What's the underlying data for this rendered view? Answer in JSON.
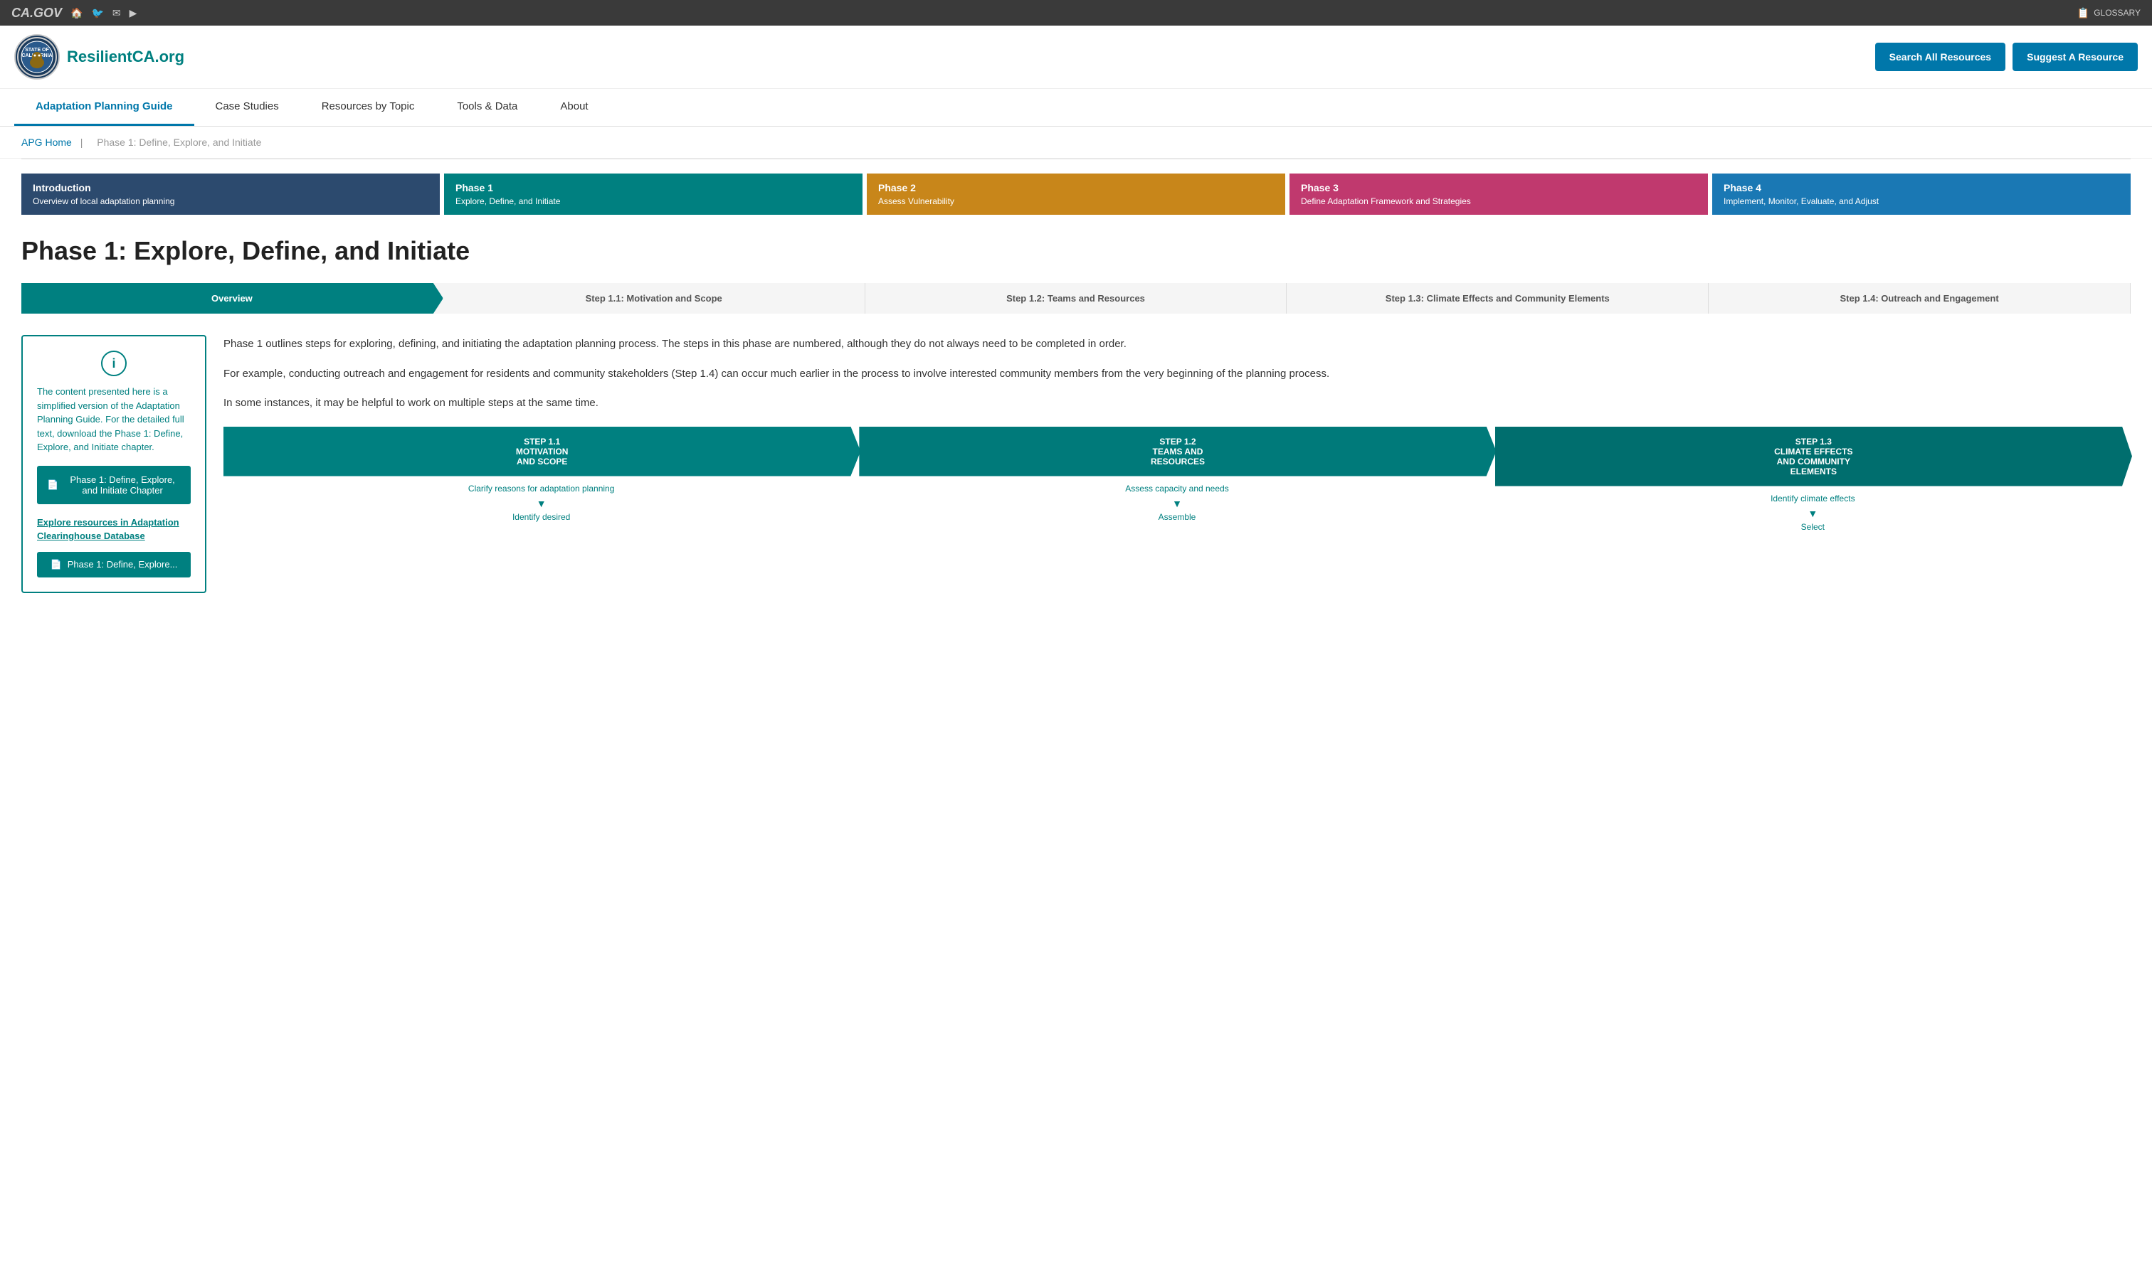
{
  "topbar": {
    "logo_text": "CA.GOV",
    "glossary_label": "GLOSSARY",
    "icons": [
      "🏠",
      "🐦",
      "✉",
      "▶"
    ]
  },
  "header": {
    "site_name": "ResilientCA.org",
    "btn_search": "Search All Resources",
    "btn_suggest": "Suggest A Resource"
  },
  "nav": {
    "items": [
      {
        "label": "Adaptation Planning Guide",
        "active": true
      },
      {
        "label": "Case Studies",
        "active": false
      },
      {
        "label": "Resources by Topic",
        "active": false
      },
      {
        "label": "Tools & Data",
        "active": false
      },
      {
        "label": "About",
        "active": false
      }
    ]
  },
  "breadcrumb": {
    "home_label": "APG Home",
    "separator": "|",
    "current": "Phase 1: Define, Explore, and Initiate"
  },
  "phase_tabs": [
    {
      "title": "Introduction",
      "sub": "Overview of local adaptation planning",
      "color_class": "tab-intro"
    },
    {
      "title": "Phase 1",
      "sub": "Explore, Define, and Initiate",
      "color_class": "tab-phase1"
    },
    {
      "title": "Phase 2",
      "sub": "Assess Vulnerability",
      "color_class": "tab-phase2"
    },
    {
      "title": "Phase 3",
      "sub": "Define Adaptation Framework and Strategies",
      "color_class": "tab-phase3"
    },
    {
      "title": "Phase 4",
      "sub": "Implement, Monitor, Evaluate, and Adjust",
      "color_class": "tab-phase4"
    }
  ],
  "page": {
    "title": "Phase 1: Explore, Define, and Initiate"
  },
  "steps": [
    {
      "label": "Overview",
      "active": true
    },
    {
      "label": "Step 1.1: Motivation and Scope",
      "active": false
    },
    {
      "label": "Step 1.2: Teams and Resources",
      "active": false
    },
    {
      "label": "Step 1.3: Climate Effects and Community Elements",
      "active": false
    },
    {
      "label": "Step 1.4: Outreach and Engagement",
      "active": false
    }
  ],
  "sidebar": {
    "info_text": "The content presented here is a simplified version of the Adaptation Planning Guide. For the detailed full text, download the Phase 1: Define, Explore, and Initiate chapter.",
    "btn_chapter": "Phase 1: Define, Explore, and Initiate Chapter",
    "link_explore": "Explore resources in Adaptation Clearinghouse Database",
    "btn_explore": "Phase 1: Define, Explore..."
  },
  "body": {
    "p1": "Phase 1 outlines steps for exploring, defining, and initiating the adaptation planning process. The steps in this phase are numbered, although they do not always need to be completed in order.",
    "p2": "For example, conducting outreach and engagement for residents and community stakeholders (Step 1.4) can occur much earlier in the process to involve interested community members from the very beginning of the planning process.",
    "p3": "In some instances, it may be helpful to work on multiple steps at the same time."
  },
  "diagram": {
    "steps": [
      {
        "header": "STEP 1.1\nMOTIVATION\nAND SCOPE",
        "items": [
          "Clarify reasons for adaptation planning",
          "Identify desired"
        ]
      },
      {
        "header": "STEP 1.2\nTEAMS AND\nRESOURCES",
        "items": [
          "Assess capacity and needs",
          "Assemble"
        ]
      },
      {
        "header": "STEP 1.3\nCLIMATE EFFECTS\nAND COMMUNITY\nELEMENTS",
        "items": [
          "Identify climate effects",
          "Select"
        ]
      }
    ]
  }
}
